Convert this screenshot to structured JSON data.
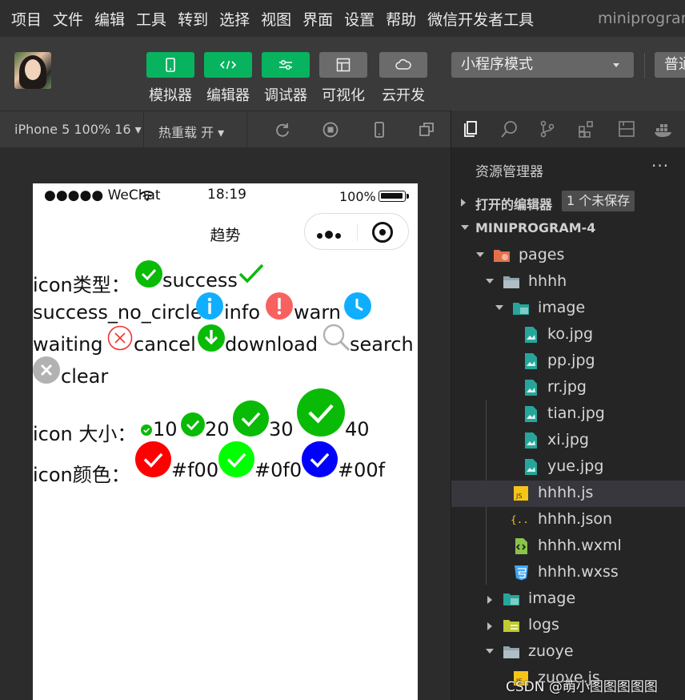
{
  "menu": {
    "items": [
      "项目",
      "文件",
      "编辑",
      "工具",
      "转到",
      "选择",
      "视图",
      "界面",
      "设置",
      "帮助",
      "微信开发者工具"
    ],
    "app_title": "miniprogram"
  },
  "toolbar": {
    "buttons": [
      {
        "label": "模拟器",
        "icon": "phone-icon",
        "active": true
      },
      {
        "label": "编辑器",
        "icon": "code-icon",
        "active": true
      },
      {
        "label": "调试器",
        "icon": "debug-icon",
        "active": true
      },
      {
        "label": "可视化",
        "icon": "layout-icon",
        "active": false
      },
      {
        "label": "云开发",
        "icon": "cloud-icon",
        "active": false
      }
    ],
    "mode_select": "小程序模式",
    "compile_select": "普通编译",
    "colors": {
      "active": "#08b35f",
      "inactive": "#6b6b6b"
    }
  },
  "simbar": {
    "device": "iPhone 5 100% 16 ▾",
    "hot_reload": "热重载 开 ▾"
  },
  "phone": {
    "status": {
      "carrier": "●●●●● WeChat",
      "time": "18:19",
      "battery": "100%"
    },
    "nav_title": "趋势",
    "content": {
      "type_label": "icon类型：",
      "types": [
        "success",
        "success_no_circle",
        "info",
        "warn",
        "waiting",
        "cancel",
        "download",
        "search",
        "clear"
      ],
      "size_label": "icon 大小：",
      "sizes": [
        "10",
        "20",
        "30",
        "40"
      ],
      "color_label": "icon颜色：",
      "colors": [
        "#f00",
        "#0f0",
        "#00f"
      ]
    }
  },
  "explorer": {
    "title": "资源管理器",
    "more": "···",
    "open_editors": "打开的编辑器",
    "unsaved": "1 个未保存",
    "project": "MINIPROGRAM-4",
    "tree": [
      {
        "name": "pages",
        "kind": "folder-pages"
      },
      {
        "name": "hhhh",
        "kind": "folder"
      },
      {
        "name": "image",
        "kind": "folder-image"
      },
      {
        "name": "ko.jpg",
        "kind": "image-file"
      },
      {
        "name": "pp.jpg",
        "kind": "image-file"
      },
      {
        "name": "rr.jpg",
        "kind": "image-file"
      },
      {
        "name": "tian.jpg",
        "kind": "image-file"
      },
      {
        "name": "xi.jpg",
        "kind": "image-file"
      },
      {
        "name": "yue.jpg",
        "kind": "image-file"
      },
      {
        "name": "hhhh.js",
        "kind": "js-file"
      },
      {
        "name": "hhhh.json",
        "kind": "json-file"
      },
      {
        "name": "hhhh.wxml",
        "kind": "wxml-file"
      },
      {
        "name": "hhhh.wxss",
        "kind": "wxss-file"
      },
      {
        "name": "image",
        "kind": "folder-image"
      },
      {
        "name": "logs",
        "kind": "folder-logs"
      },
      {
        "name": "zuoye",
        "kind": "folder"
      },
      {
        "name": "zuoye.js",
        "kind": "js-file"
      }
    ]
  },
  "watermark": "CSDN @萌小图图图图图"
}
